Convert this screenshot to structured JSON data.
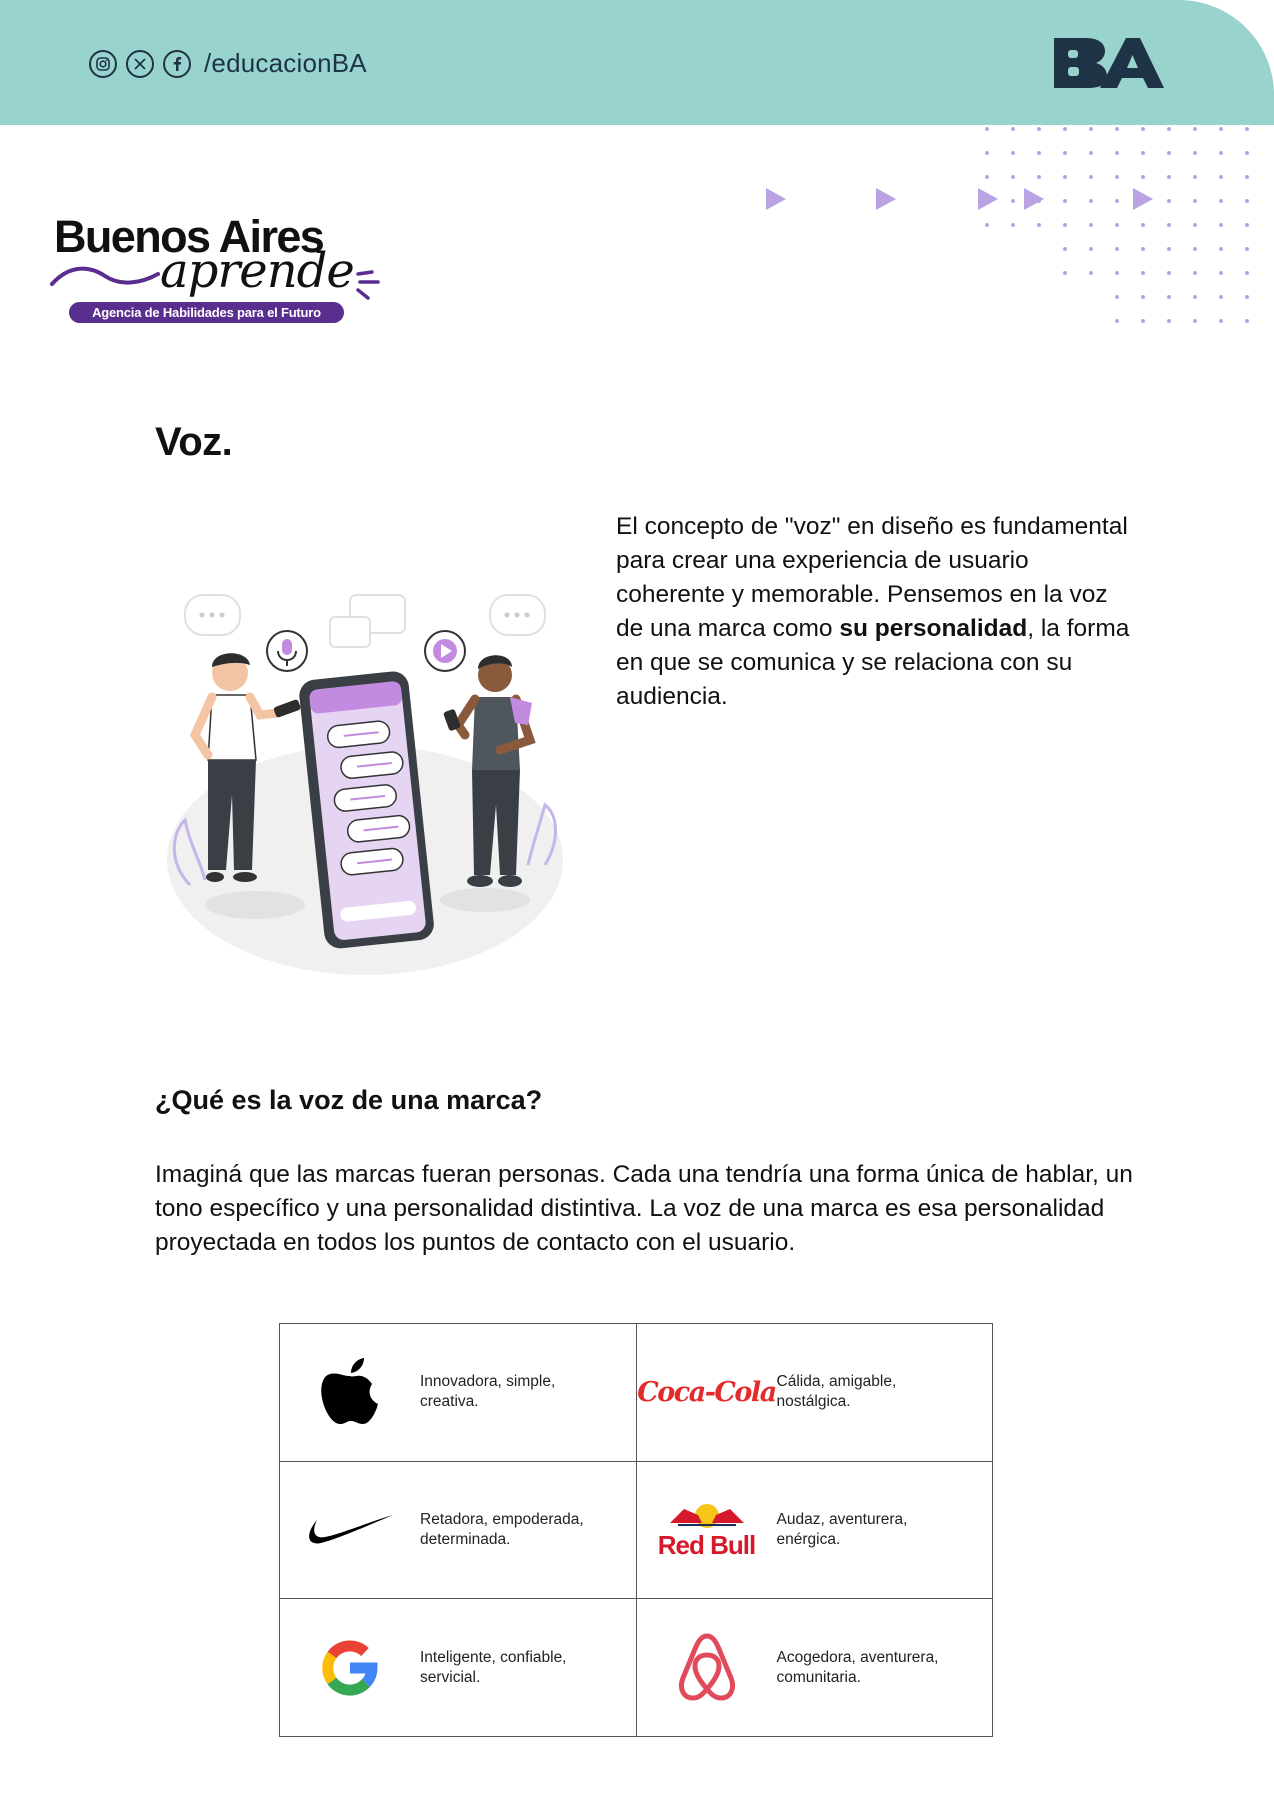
{
  "header": {
    "social_icons": [
      "instagram-icon",
      "x-icon",
      "facebook-icon"
    ],
    "handle": "/educacionBA",
    "brand_logo": "BA",
    "color": "#98d3cd"
  },
  "program_logo": {
    "title": "Buenos Aires",
    "script": "aprende",
    "tagline": "Agencia de Habilidades para el Futuro",
    "accent": "#5a2e8f"
  },
  "page_title": "Voz.",
  "intro": {
    "before": "El concepto de \"voz\" en diseño es fundamental para crear una experiencia de usuario coherente y memorable. Pensemos en la voz de una marca como ",
    "bold": "su personalidad",
    "after": ", la forma en que se comunica y se relaciona con su audiencia."
  },
  "section_heading": "¿Qué es la voz de una marca?",
  "body_text": "Imaginá que las marcas fueran personas. Cada una tendría una forma única de hablar, un tono específico y una personalidad distintiva. La voz de una marca es esa personalidad proyectada en todos los puntos de contacto con el usuario.",
  "brands": [
    {
      "logo": "apple-logo",
      "description": "Innovadora, simple, creativa."
    },
    {
      "logo": "coca-cola-logo",
      "logo_text": "Coca-Cola",
      "description": "Cálida, amigable, nostálgica."
    },
    {
      "logo": "nike-logo",
      "description": "Retadora, empoderada, determinada."
    },
    {
      "logo": "red-bull-logo",
      "logo_text": "Red Bull",
      "description": "Audaz, aventurera, enérgica."
    },
    {
      "logo": "google-logo",
      "logo_text": "G",
      "description": "Inteligente, confiable, servicial."
    },
    {
      "logo": "airbnb-logo",
      "description": "Acogedora, aventurera, comunitaria."
    }
  ],
  "colors": {
    "accent_purple": "#b9a3e3",
    "coca_cola_red": "#e32b2b",
    "red_bull_red": "#d6192a"
  }
}
